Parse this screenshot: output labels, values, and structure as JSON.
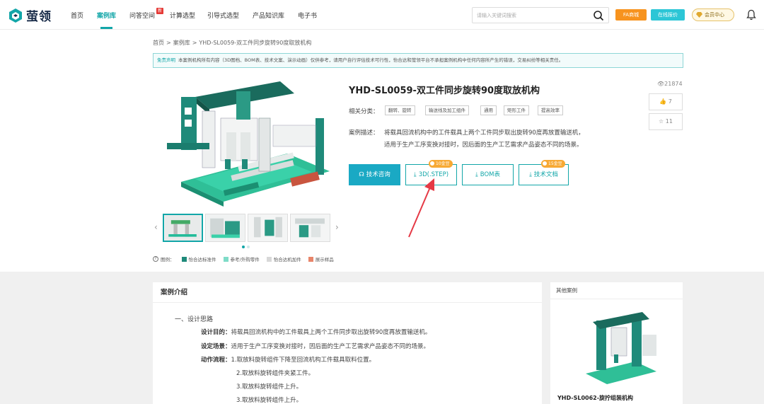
{
  "nav": {
    "logo_text": "萤领",
    "items": [
      "首页",
      "案例库",
      "问答空间",
      "计算选型",
      "引导式选型",
      "产品知识库",
      "电子书"
    ],
    "new_badge": "新",
    "search_placeholder": "请输入关键词搜索",
    "fa_label": "FA商城",
    "quote_label": "在线报价",
    "vip_label": "会员中心"
  },
  "breadcrumb": [
    "首页",
    ">",
    "案例库",
    ">",
    "YHD-SL0059-双工件同步旋转90度取放机构"
  ],
  "notice": {
    "title": "免责声明",
    "text": "本案例机构所有内容（3D图档、BOM表、技术文案、演示动画）仅供参考，请用户自行评估技术可行性，怡合达和萤领平台不承担案例机构中任何内容所产生的错误，交易纠纷等相关责任。"
  },
  "product": {
    "title": "YHD-SL0059-双工件同步旋转90度取放机构",
    "views": "21874",
    "likes": "7",
    "favorites": "11",
    "category_label": "相关分类：",
    "tags": [
      "翻转、旋转",
      "输送线及加工组件",
      "通用",
      "矩形工件",
      "提高效率"
    ],
    "desc_label": "案例描述：",
    "desc_line1": "将载具回流机构中的工件载具上两个工件同步取出旋转90度再放置输送机，",
    "desc_line2": "适用于生产工序变换对接时，因后面的生产工艺需求产品姿态不同的场景。",
    "buttons": {
      "consult": "技术咨询",
      "step": "3D(.STEP)",
      "bom": "BOM表",
      "doc": "技术文档"
    },
    "step_cost": "10金豆",
    "doc_cost": "15金豆"
  },
  "legend": {
    "label": "图例：",
    "items": [
      {
        "label": "怡合达标准件",
        "color": "#1f8a7a"
      },
      {
        "label": "参考/外购零件",
        "color": "#7fdcc8"
      },
      {
        "label": "怡合达机加件",
        "color": "#d8d8d8"
      },
      {
        "label": "展示样品",
        "color": "#e8856a"
      }
    ]
  },
  "intro": {
    "header": "案例介绍",
    "section_title": "一、设计思路",
    "purpose_label": "设计目的：",
    "purpose_text": "将载具回流机构中的工件载具上两个工件同步取出旋转90度再放置输送机。",
    "scene_label": "设定场景：",
    "scene_text": "适用于生产工序变换对接时，因后面的生产工艺需求产品姿态不同的场景。",
    "flow_label": "动作流程：",
    "steps": [
      "1.取放料旋转组件下降至回流机构工件载具取料位置。",
      "2.取放料旋转组件夹紧工件。",
      "3.取放料旋转组件上升。",
      "3.取放料旋转组件上升。"
    ]
  },
  "others": {
    "header": "其他案例",
    "title": "YHD-SL0062-旋拧组装机构"
  },
  "colors": {
    "accent": "#12a6a8",
    "primary_button": "#1aa9c4",
    "gold": "#f7a934",
    "arrow": "#e53945"
  }
}
